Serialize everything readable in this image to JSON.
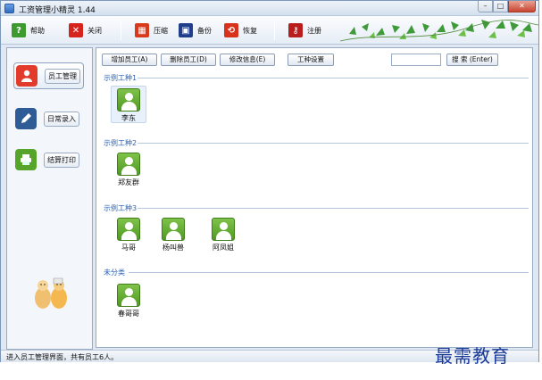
{
  "window": {
    "title": "工资管理小精灵 1.44"
  },
  "titlebar_buttons": {
    "minimize": "–",
    "maximize": "□",
    "close": "✕"
  },
  "toolbar": {
    "items": [
      {
        "label": "帮助",
        "icon": "help-icon",
        "glyph": "?",
        "color": "#3c9a2e"
      },
      {
        "label": "关闭",
        "icon": "close-icon",
        "glyph": "✕",
        "color": "#d6231c"
      },
      {
        "label": "压缩",
        "icon": "compress-icon",
        "glyph": "▦",
        "color": "#d93a1c"
      },
      {
        "label": "备份",
        "icon": "backup-icon",
        "glyph": "▣",
        "color": "#1f3f8a"
      },
      {
        "label": "恢复",
        "icon": "restore-icon",
        "glyph": "⟲",
        "color": "#d9321c"
      },
      {
        "label": "注册",
        "icon": "key-icon",
        "glyph": "⚷",
        "color": "#b81c1c"
      }
    ]
  },
  "sidebar": {
    "items": [
      {
        "label": "员工管理",
        "icon": "employee-icon",
        "color": "#e23b2b",
        "active": true
      },
      {
        "label": "日常录入",
        "icon": "pen-icon",
        "color": "#2f5b96",
        "active": false
      },
      {
        "label": "结算打印",
        "icon": "printer-icon",
        "color": "#56a52a",
        "active": false
      }
    ]
  },
  "actions": {
    "add": "增加员工(A)",
    "delete": "删除员工(D)",
    "edit": "修改信息(E)",
    "worktype": "工种设置",
    "search_value": "",
    "search": "搜 索 (Enter)"
  },
  "groups": [
    {
      "title": "示例工种1",
      "employees": [
        "李东"
      ]
    },
    {
      "title": "示例工种2",
      "employees": [
        "郑友群"
      ]
    },
    {
      "title": "示例工种3",
      "employees": [
        "马哥",
        "杨叫兽",
        "阿凤姐"
      ]
    },
    {
      "title": "未分类",
      "employees": [
        "春哥哥"
      ]
    }
  ],
  "status": {
    "text": "进入员工管理界面，共有员工6人。"
  },
  "watermark": "最需教育",
  "colors": {
    "accent": "#2862b8",
    "avatar": "#5aa82a",
    "leaves": "#3f9a3a"
  }
}
